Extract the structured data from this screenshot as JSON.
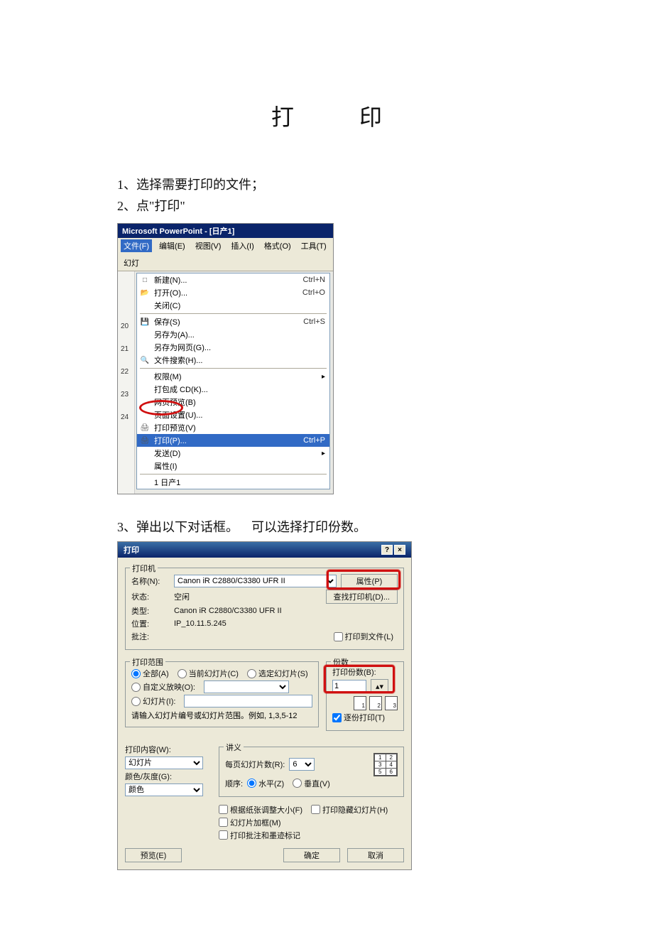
{
  "title": "打　印",
  "steps": {
    "s1": "1、选择需要打印的文件；",
    "s2": "2、点\"打印\"",
    "s3a": "3、弹出以下对话框。",
    "s3b": "可以选择打印份数。"
  },
  "ppt": {
    "titlebar": "Microsoft PowerPoint - [日产1]",
    "menubar": [
      "文件(F)",
      "编辑(E)",
      "视图(V)",
      "插入(I)",
      "格式(O)",
      "工具(T)",
      "幻灯"
    ],
    "gutter": [
      "20",
      "21",
      "22",
      "23",
      "24"
    ],
    "items": [
      {
        "icon": "□",
        "label": "新建(N)...",
        "accel": "Ctrl+N"
      },
      {
        "icon": "📂",
        "label": "打开(O)...",
        "accel": "Ctrl+O"
      },
      {
        "icon": "",
        "label": "关闭(C)",
        "accel": ""
      },
      {
        "sep": true
      },
      {
        "icon": "💾",
        "label": "保存(S)",
        "accel": "Ctrl+S"
      },
      {
        "icon": "",
        "label": "另存为(A)...",
        "accel": ""
      },
      {
        "icon": "",
        "label": "另存为网页(G)...",
        "accel": ""
      },
      {
        "icon": "🔍",
        "label": "文件搜索(H)...",
        "accel": ""
      },
      {
        "sep": true
      },
      {
        "icon": "",
        "label": "权限(M)",
        "accel": "",
        "arrow": true
      },
      {
        "icon": "",
        "label": "打包成 CD(K)...",
        "accel": ""
      },
      {
        "icon": "",
        "label": "网页预览(B)",
        "accel": ""
      },
      {
        "icon": "",
        "label": "页面设置(U)...",
        "accel": ""
      },
      {
        "icon": "🖨",
        "label": "打印预览(V)",
        "accel": ""
      },
      {
        "icon": "🖨",
        "label": "打印(P)...",
        "accel": "Ctrl+P",
        "sel": true
      },
      {
        "icon": "",
        "label": "发送(D)",
        "accel": "",
        "arrow": true
      },
      {
        "icon": "",
        "label": "属性(I)",
        "accel": ""
      },
      {
        "sep": true
      },
      {
        "icon": "",
        "label": "1 日产1",
        "accel": ""
      }
    ]
  },
  "dlg": {
    "title": "打印",
    "printer_legend": "打印机",
    "name_lbl": "名称(N):",
    "name_val": "Canon iR C2880/C3380 UFR II",
    "status_lbl": "状态:",
    "status_val": "空闲",
    "type_lbl": "类型:",
    "type_val": "Canon iR C2880/C3380 UFR II",
    "where_lbl": "位置:",
    "where_val": "IP_10.11.5.245",
    "comment_lbl": "批注:",
    "prop_btn": "属性(P)",
    "find_btn": "查找打印机(D)...",
    "to_file": "打印到文件(L)",
    "range_legend": "打印范围",
    "range_all": "全部(A)",
    "range_current": "当前幻灯片(C)",
    "range_selected": "选定幻灯片(S)",
    "range_custom": "自定义放映(O):",
    "range_slides": "幻灯片(I):",
    "range_hint": "请输入幻灯片编号或幻灯片范围。例如, 1,3,5-12",
    "copies_legend": "份数",
    "copies_lbl": "打印份数(B):",
    "copies_val": "1",
    "collate": "逐份打印(T)",
    "what_lbl": "打印内容(W):",
    "what_val": "幻灯片",
    "color_lbl": "颜色/灰度(G):",
    "color_val": "颜色",
    "handout_legend": "讲义",
    "handout_per": "每页幻灯片数(R):",
    "handout_per_val": "6",
    "order_lbl": "顺序:",
    "order_h": "水平(Z)",
    "order_v": "垂直(V)",
    "scale": "根据纸张调整大小(F)",
    "hidden": "打印隐藏幻灯片(H)",
    "frame": "幻灯片加框(M)",
    "ink": "打印批注和墨迹标记",
    "preview_btn": "预览(E)",
    "ok_btn": "确定",
    "cancel_btn": "取消"
  }
}
